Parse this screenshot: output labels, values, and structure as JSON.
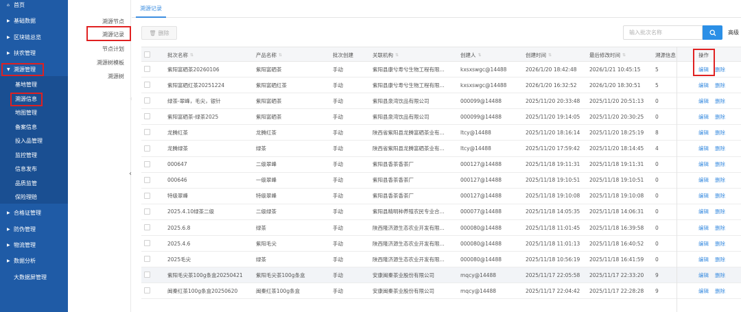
{
  "nav": {
    "items": [
      {
        "label": "首页",
        "icon": "home-icon"
      },
      {
        "label": "基础数据"
      },
      {
        "label": "区块链总览"
      },
      {
        "label": "扶农管理"
      },
      {
        "label": "溯源管理",
        "expanded": true
      }
    ],
    "sub_items": [
      "基地管理",
      "溯源信息",
      "地图管理",
      "备案信息",
      "投入品管理",
      "监控管理",
      "信息发布",
      "品质监管",
      "保险理赔"
    ],
    "items_after": [
      {
        "label": "合格证管理"
      },
      {
        "label": "防伪管理"
      },
      {
        "label": "物流管理"
      },
      {
        "label": "数据分析"
      },
      {
        "label": "大数据屏管理"
      }
    ]
  },
  "subnav": {
    "items": [
      "溯源节点",
      "溯源记录",
      "节点计划",
      "溯源树模板",
      "溯源树"
    ]
  },
  "tab": {
    "label": "溯源记录"
  },
  "toolbar": {
    "delete_label": "删除",
    "search_placeholder": "输入批次名称",
    "advanced_label": "高级"
  },
  "table": {
    "headers": [
      "批次名称",
      "产品名称",
      "批次创建",
      "关联机构",
      "创建人",
      "创建时间",
      "最后修改时间",
      "溯源信息",
      "操作"
    ],
    "edit_label": "编辑",
    "delete_label": "删除",
    "rows": [
      [
        "紫阳富硒茶20260106",
        "紫阳富硒茶",
        "手动",
        "紫阳县康兮寿兮生物工程有限...",
        "kxsxswgc@14488",
        "2026/1/20 18:42:48",
        "2026/1/21 10:45:15",
        "5"
      ],
      [
        "紫阳富硒红茶20251224",
        "紫阳富硒红茶",
        "手动",
        "紫阳县康兮寿兮生物工程有限...",
        "kxsxswgc@14488",
        "2026/1/20 16:32:52",
        "2026/1/20 18:30:51",
        "5"
      ],
      [
        "绿茶-翠峰，毛尖，银针",
        "紫阳富硒茶",
        "手动",
        "紫阳县泉湾饮品有限公司",
        "000099@14488",
        "2025/11/20 20:33:48",
        "2025/11/20 20:51:13",
        "0"
      ],
      [
        "紫阳富硒茶-绿茶2025",
        "紫阳富硒茶",
        "手动",
        "紫阳县泉湾饮品有限公司",
        "000099@14488",
        "2025/11/20 19:14:05",
        "2025/11/20 20:30:25",
        "0"
      ],
      [
        "龙腾红茶",
        "龙腾红茶",
        "手动",
        "陕西省紫阳县龙腾富硒茶业有...",
        "ltcy@14488",
        "2025/11/20 18:16:14",
        "2025/11/20 18:25:19",
        "8"
      ],
      [
        "龙腾绿茶",
        "绿茶",
        "手动",
        "陕西省紫阳县龙腾富硒茶业有...",
        "ltcy@14488",
        "2025/11/20 17:59:42",
        "2025/11/20 18:14:45",
        "4"
      ],
      [
        "000647",
        "二级翠峰",
        "手动",
        "紫阳县香茶香茶厂",
        "000127@14488",
        "2025/11/18 19:11:31",
        "2025/11/18 19:11:31",
        "0"
      ],
      [
        "000646",
        "一级翠峰",
        "手动",
        "紫阳县香茶香茶厂",
        "000127@14488",
        "2025/11/18 19:10:51",
        "2025/11/18 19:10:51",
        "0"
      ],
      [
        "特级翠峰",
        "特级翠峰",
        "手动",
        "紫阳县香茶香茶厂",
        "000127@14488",
        "2025/11/18 19:10:08",
        "2025/11/18 19:10:08",
        "0"
      ],
      [
        "2025.4.10绿茶二级",
        "二级绿茶",
        "手动",
        "紫阳县精明种养殖农民专业合...",
        "000077@14488",
        "2025/11/18 14:05:35",
        "2025/11/18 14:06:31",
        "0"
      ],
      [
        "2025.6.8",
        "绿茶",
        "手动",
        "陕西隆济源生态农业开发有限...",
        "000080@14488",
        "2025/11/18 11:01:45",
        "2025/11/18 16:39:58",
        "0"
      ],
      [
        "2025.4.6",
        "紫阳毛尖",
        "手动",
        "陕西隆济源生态农业开发有限...",
        "000080@14488",
        "2025/11/18 11:01:13",
        "2025/11/18 16:40:52",
        "0"
      ],
      [
        "2025毛尖",
        "绿茶",
        "手动",
        "陕西隆济源生态农业开发有限...",
        "000080@14488",
        "2025/11/18 10:56:19",
        "2025/11/18 16:41:59",
        "0"
      ],
      [
        "紫阳毛尖茶100g条盒20250421",
        "紫阳毛尖茶100g条盒",
        "手动",
        "安康闽秦茶业股份有限公司",
        "mqcy@14488",
        "2025/11/17 22:05:58",
        "2025/11/17 22:33:20",
        "9"
      ],
      [
        "闽秦红茶100g条盒20250620",
        "闽秦红茶100g条盒",
        "手动",
        "安康闽秦茶业股份有限公司",
        "mqcy@14488",
        "2025/11/17 22:04:42",
        "2025/11/17 22:28:28",
        "9"
      ]
    ]
  }
}
